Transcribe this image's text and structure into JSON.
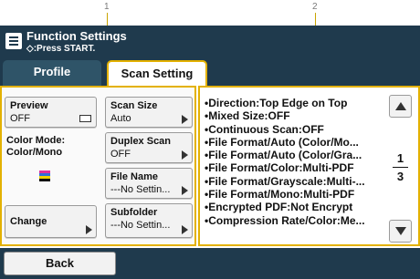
{
  "markers": [
    "1",
    "2"
  ],
  "header": {
    "title": "Function Settings",
    "subtitle": "◇:Press START."
  },
  "tabs": [
    {
      "label": "Profile",
      "active": false
    },
    {
      "label": "Scan Setting",
      "active": true
    }
  ],
  "left_panel": {
    "preview": {
      "label": "Preview",
      "value": "OFF"
    },
    "color_mode": {
      "label": "Color Mode:",
      "value": "Color/Mono"
    },
    "change": {
      "label": "Change"
    },
    "scan_size": {
      "label": "Scan Size",
      "value": "Auto"
    },
    "duplex_scan": {
      "label": "Duplex Scan",
      "value": "OFF"
    },
    "file_name": {
      "label": "File Name",
      "value": "---No Settin..."
    },
    "subfolder": {
      "label": "Subfolder",
      "value": "---No Settin..."
    }
  },
  "settings_list": [
    "•Direction:Top Edge on Top",
    "•Mixed Size:OFF",
    "•Continuous Scan:OFF",
    "•File Format/Auto (Color/Mo...",
    "•File Format/Auto (Color/Gra...",
    "•File Format/Color:Multi-PDF",
    "•File Format/Grayscale:Multi-...",
    "•File Format/Mono:Multi-PDF",
    "•Encrypted PDF:Not Encrypt",
    "•Compression Rate/Color:Me..."
  ],
  "pager": {
    "current": "1",
    "total": "3"
  },
  "footer": {
    "back_label": "Back"
  },
  "colors": {
    "header_bg": "#1f3a4d",
    "accent": "#e3b100",
    "button_bg": "#f2f2f2"
  }
}
